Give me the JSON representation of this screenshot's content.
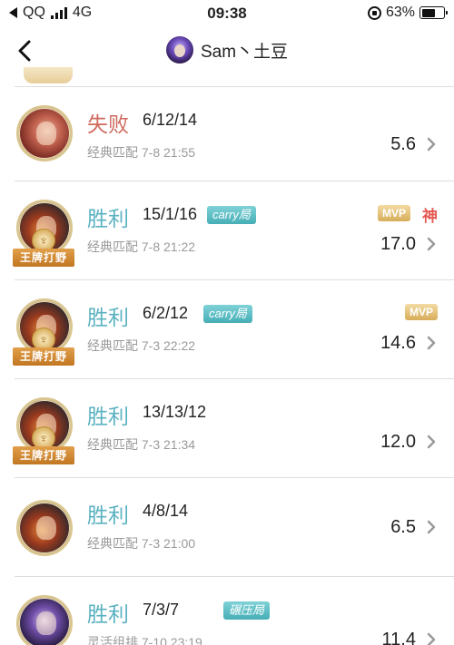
{
  "status_bar": {
    "carrier": "QQ",
    "network": "4G",
    "time": "09:38",
    "battery": "63%",
    "battery_level": 0.63
  },
  "header": {
    "title": "Sam丶土豆"
  },
  "matches": [
    {
      "result": "失败",
      "kda": "6/12/14",
      "tag": "",
      "mode": "经典匹配",
      "time": "7-8 21:55",
      "score": "5.6",
      "mvp": "",
      "god": "",
      "badge": ""
    },
    {
      "result": "胜利",
      "kda": "15/1/16",
      "tag": "carry局",
      "mode": "经典匹配",
      "time": "7-8 21:22",
      "score": "17.0",
      "mvp": "MVP",
      "god": "神",
      "badge": "王牌打野"
    },
    {
      "result": "胜利",
      "kda": "6/2/12",
      "tag": "carry局",
      "mode": "经典匹配",
      "time": "7-3 22:22",
      "score": "14.6",
      "mvp": "MVP",
      "god": "",
      "badge": "王牌打野"
    },
    {
      "result": "胜利",
      "kda": "13/13/12",
      "tag": "",
      "mode": "经典匹配",
      "time": "7-3 21:34",
      "score": "12.0",
      "mvp": "",
      "god": "",
      "badge": "王牌打野"
    },
    {
      "result": "胜利",
      "kda": "4/8/14",
      "tag": "",
      "mode": "经典匹配",
      "time": "7-3 21:00",
      "score": "6.5",
      "mvp": "",
      "god": "",
      "badge": ""
    },
    {
      "result": "胜利",
      "kda": "7/3/7",
      "tag": "碾压局",
      "mode": "灵活组排",
      "time": "7-10 23:19",
      "score": "11.4",
      "mvp": "",
      "god": "",
      "badge": ""
    }
  ],
  "icons": {
    "back": "chevron-left-icon",
    "row_arrow": "chevron-right-icon"
  },
  "colors": {
    "win": "#5bb2c1",
    "lose": "#cf6a5e",
    "tag": "#46aeb6",
    "badge": "#c27622",
    "god": "#e45b54"
  }
}
